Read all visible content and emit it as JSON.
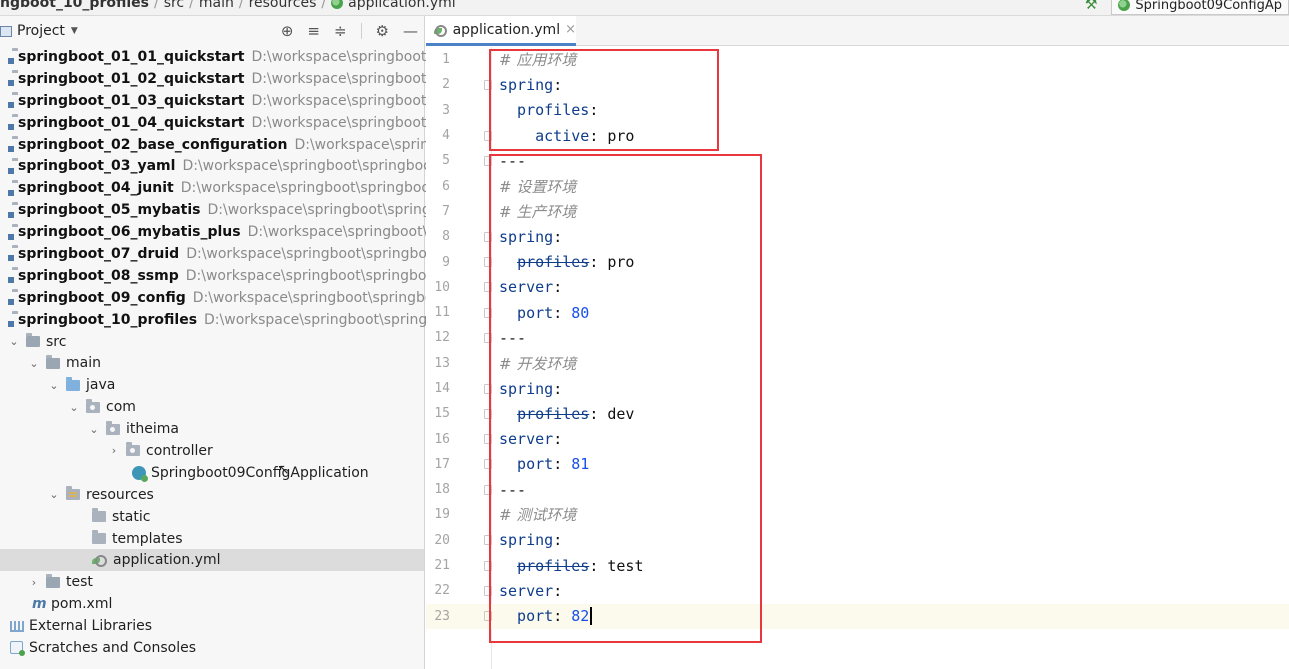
{
  "breadcrumb": [
    "ngboot_10_profiles",
    "src",
    "main",
    "resources",
    "application.yml"
  ],
  "run_config": "Springboot09ConfigAp",
  "project_panel": {
    "title": "Project"
  },
  "modules": [
    {
      "name": "springboot_01_01_quickstart",
      "path": "D:\\workspace\\springboot\\s"
    },
    {
      "name": "springboot_01_02_quickstart",
      "path": "D:\\workspace\\springboot\\s"
    },
    {
      "name": "springboot_01_03_quickstart",
      "path": "D:\\workspace\\springboot\\s"
    },
    {
      "name": "springboot_01_04_quickstart",
      "path": "D:\\workspace\\springboot\\s"
    },
    {
      "name": "springboot_02_base_configuration",
      "path": "D:\\workspace\\springb"
    },
    {
      "name": "springboot_03_yaml",
      "path": "D:\\workspace\\springboot\\springboo"
    },
    {
      "name": "springboot_04_junit",
      "path": "D:\\workspace\\springboot\\springboo"
    },
    {
      "name": "springboot_05_mybatis",
      "path": "D:\\workspace\\springboot\\springb"
    },
    {
      "name": "springboot_06_mybatis_plus",
      "path": "D:\\workspace\\springboot\\sp"
    },
    {
      "name": "springboot_07_druid",
      "path": "D:\\workspace\\springboot\\springboc"
    },
    {
      "name": "springboot_08_ssmp",
      "path": "D:\\workspace\\springboot\\springboc"
    },
    {
      "name": "springboot_09_config",
      "path": "D:\\workspace\\springboot\\springbo"
    },
    {
      "name": "springboot_10_profiles",
      "path": "D:\\workspace\\springboot\\springb"
    }
  ],
  "tree": {
    "src": "src",
    "main": "main",
    "java": "java",
    "com": "com",
    "itheima": "itheima",
    "controller": "controller",
    "app_class": "Springboot09ConfigApplication",
    "resources": "resources",
    "static": "static",
    "templates": "templates",
    "application_yml": "application.yml",
    "test": "test",
    "pom": "pom.xml",
    "external_libraries": "External Libraries",
    "scratches": "Scratches and Consoles"
  },
  "editor": {
    "tab_label": "application.yml",
    "lines": [
      {
        "n": "1",
        "parts": [
          {
            "t": "# 应用环境",
            "c": "cmt"
          }
        ]
      },
      {
        "n": "2",
        "parts": [
          {
            "t": "spring",
            "c": "k"
          },
          {
            "t": ":",
            "c": "v"
          }
        ]
      },
      {
        "n": "3",
        "parts": [
          {
            "t": "  profiles",
            "c": "k"
          },
          {
            "t": ":",
            "c": "v"
          }
        ]
      },
      {
        "n": "4",
        "parts": [
          {
            "t": "    active",
            "c": "k"
          },
          {
            "t": ": pro",
            "c": "v"
          }
        ]
      },
      {
        "n": "5",
        "parts": [
          {
            "t": "---",
            "c": "v"
          }
        ]
      },
      {
        "n": "6",
        "parts": [
          {
            "t": "# 设置环境",
            "c": "cmt"
          }
        ]
      },
      {
        "n": "7",
        "parts": [
          {
            "t": "# 生产环境",
            "c": "cmt"
          }
        ]
      },
      {
        "n": "8",
        "parts": [
          {
            "t": "spring",
            "c": "k"
          },
          {
            "t": ":",
            "c": "v"
          }
        ]
      },
      {
        "n": "9",
        "parts": [
          {
            "t": "  ",
            "c": "v"
          },
          {
            "t": "profiles",
            "c": "k strike"
          },
          {
            "t": ": pro",
            "c": "v"
          }
        ]
      },
      {
        "n": "10",
        "parts": [
          {
            "t": "server",
            "c": "k"
          },
          {
            "t": ":",
            "c": "v"
          }
        ]
      },
      {
        "n": "11",
        "parts": [
          {
            "t": "  port",
            "c": "k"
          },
          {
            "t": ": ",
            "c": "v"
          },
          {
            "t": "80",
            "c": "num"
          }
        ]
      },
      {
        "n": "12",
        "parts": [
          {
            "t": "---",
            "c": "v"
          }
        ]
      },
      {
        "n": "13",
        "parts": [
          {
            "t": "# 开发环境",
            "c": "cmt"
          }
        ]
      },
      {
        "n": "14",
        "parts": [
          {
            "t": "spring",
            "c": "k"
          },
          {
            "t": ":",
            "c": "v"
          }
        ]
      },
      {
        "n": "15",
        "parts": [
          {
            "t": "  ",
            "c": "v"
          },
          {
            "t": "profiles",
            "c": "k strike"
          },
          {
            "t": ": dev",
            "c": "v"
          }
        ]
      },
      {
        "n": "16",
        "parts": [
          {
            "t": "server",
            "c": "k"
          },
          {
            "t": ":",
            "c": "v"
          }
        ]
      },
      {
        "n": "17",
        "parts": [
          {
            "t": "  port",
            "c": "k"
          },
          {
            "t": ": ",
            "c": "v"
          },
          {
            "t": "81",
            "c": "num"
          }
        ]
      },
      {
        "n": "18",
        "parts": [
          {
            "t": "---",
            "c": "v"
          }
        ]
      },
      {
        "n": "19",
        "parts": [
          {
            "t": "# 测试环境",
            "c": "cmt"
          }
        ]
      },
      {
        "n": "20",
        "parts": [
          {
            "t": "spring",
            "c": "k"
          },
          {
            "t": ":",
            "c": "v"
          }
        ]
      },
      {
        "n": "21",
        "parts": [
          {
            "t": "  ",
            "c": "v"
          },
          {
            "t": "profiles",
            "c": "k strike"
          },
          {
            "t": ": test",
            "c": "v"
          }
        ]
      },
      {
        "n": "22",
        "parts": [
          {
            "t": "server",
            "c": "k"
          },
          {
            "t": ":",
            "c": "v"
          }
        ]
      },
      {
        "n": "23",
        "parts": [
          {
            "t": "  port",
            "c": "k"
          },
          {
            "t": ": ",
            "c": "v"
          },
          {
            "t": "82",
            "c": "num"
          }
        ]
      }
    ]
  },
  "colors": {
    "highlight_box": "#e8383d",
    "keyword": "#0f3d8c",
    "number": "#1750eb",
    "comment": "#8c8c8c",
    "tab_underline": "#4a83c6"
  }
}
